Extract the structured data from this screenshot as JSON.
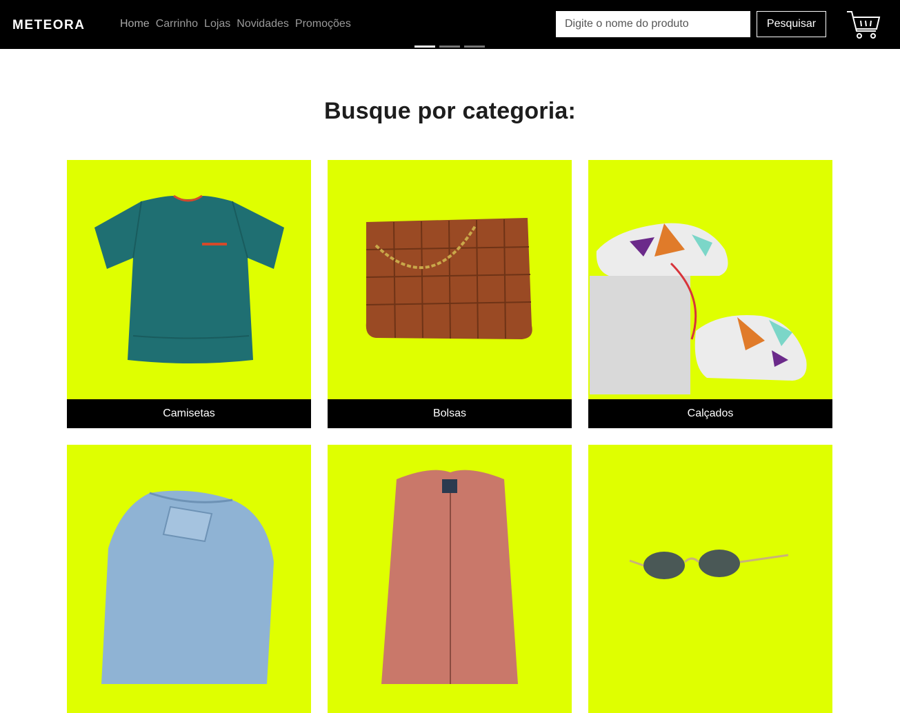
{
  "brand": {
    "logo_text": "METEORA"
  },
  "nav": {
    "links": [
      {
        "label": "Home"
      },
      {
        "label": "Carrinho"
      },
      {
        "label": "Lojas"
      },
      {
        "label": "Novidades"
      },
      {
        "label": "Promoções"
      }
    ]
  },
  "search": {
    "placeholder": "Digite o nome do produto",
    "value": "",
    "button_label": "Pesquisar"
  },
  "carousel": {
    "slides": 3,
    "active_index": 0
  },
  "main": {
    "title": "Busque por categoria:",
    "categories": [
      {
        "label": "Camisetas",
        "image": "teal-tshirt"
      },
      {
        "label": "Bolsas",
        "image": "brown-woven-bag"
      },
      {
        "label": "Calçados",
        "image": "sneakers"
      },
      {
        "label": "",
        "image": "denim-jeans"
      },
      {
        "label": "",
        "image": "pink-jacket"
      },
      {
        "label": "",
        "image": "sunglasses"
      }
    ]
  },
  "colors": {
    "navbar_bg": "#000000",
    "card_bg": "#dfff00",
    "label_bar_bg": "#000000",
    "title_text": "#1d1d1d"
  },
  "icons": [
    "cart-icon"
  ]
}
